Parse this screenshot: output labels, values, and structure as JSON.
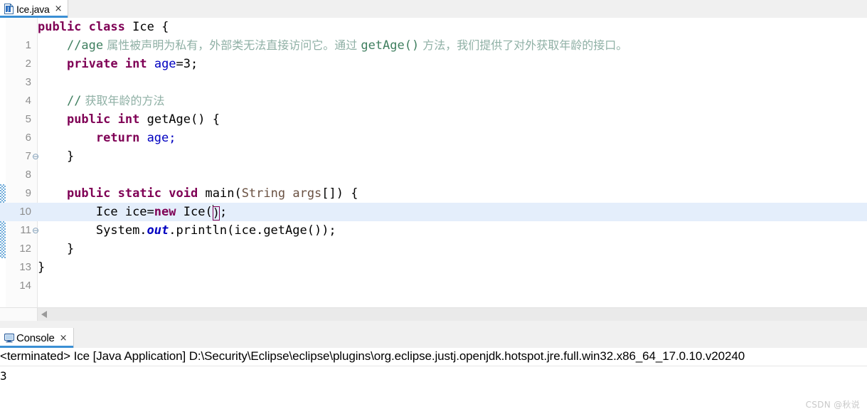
{
  "editor": {
    "tab": {
      "label": "Ice.java",
      "icon": "java-file-icon",
      "close_label": "×"
    },
    "lines": [
      {
        "num": "1",
        "fold": "",
        "current": false,
        "change": false
      },
      {
        "num": "2",
        "fold": "",
        "current": false,
        "change": false
      },
      {
        "num": "3",
        "fold": "",
        "current": false,
        "change": false
      },
      {
        "num": "4",
        "fold": "",
        "current": false,
        "change": false
      },
      {
        "num": "5",
        "fold": "",
        "current": false,
        "change": false
      },
      {
        "num": "6",
        "fold": "⊖",
        "current": false,
        "change": false
      },
      {
        "num": "7",
        "fold": "",
        "current": false,
        "change": false
      },
      {
        "num": "8",
        "fold": "",
        "current": false,
        "change": false
      },
      {
        "num": "9",
        "fold": "",
        "current": false,
        "change": false
      },
      {
        "num": "10",
        "fold": "⊖",
        "current": false,
        "change": true
      },
      {
        "num": "11",
        "fold": "",
        "current": true,
        "change": true
      },
      {
        "num": "12",
        "fold": "",
        "current": false,
        "change": true
      },
      {
        "num": "13",
        "fold": "",
        "current": false,
        "change": true
      },
      {
        "num": "14",
        "fold": "",
        "current": false,
        "change": false
      }
    ],
    "code_text": [
      "public class Ice {",
      "    //age 属性被声明为私有，外部类无法直接访问它。通过 getAge() 方法，我们提供了对外获取年龄的接口。",
      "    private int age=3;",
      "",
      "    // 获取年龄的方法",
      "    public int getAge() {",
      "        return age;",
      "    }",
      "",
      "    public static void main(String args[]) {",
      "        Ice ice=new Ice();",
      "        System.out.println(ice.getAge());",
      "    }",
      "}"
    ],
    "comment_line2": {
      "slashes": "//age",
      "cjk": " 属性被声明为私有，外部类无法直接访问它。通过 ",
      "code": "getAge()",
      "cjk2": " 方法，我们提供了对外获取年龄的接口。"
    },
    "comment_line5": {
      "slashes": "//",
      "cjk": " 获取年龄的方法"
    },
    "tokens": {
      "public": "public",
      "class": "class",
      "private": "private",
      "static": "static",
      "void": "void",
      "int": "int",
      "return": "return",
      "new": "new",
      "ice_type": "Ice",
      "brace_open": " {",
      "brace_close": "}",
      "age": "age",
      "age_init": "=3;",
      "getage_sig": "getAge() {",
      "return_age": "age;",
      "main_sig": "main(",
      "string_type": "String",
      "args": " args",
      "args_brackets": "[]) {",
      "decl_ice": "Ice ice=",
      "new_call": "Ice(",
      "paren_close": ")",
      "semicolon": ";",
      "system": "System.",
      "out": "out",
      "println_call": ".println(ice.getAge());",
      "space4": "    ",
      "space8": "        "
    },
    "scrollbar": {
      "left_arrow": "scroll-left-arrow"
    }
  },
  "console": {
    "tab": {
      "label": "Console",
      "icon": "console-icon",
      "close_label": "×"
    },
    "header": "<terminated> Ice [Java Application] D:\\Security\\Eclipse\\eclipse\\plugins\\org.eclipse.justj.openjdk.hotspot.jre.full.win32.x86_64_17.0.10.v20240",
    "output": "3"
  },
  "watermark": "CSDN @秋说",
  "colors": {
    "keyword": "#7f0055",
    "field": "#0000c0",
    "comment": "#3f7f5f",
    "comment_cjk": "#8fb0a5",
    "parameter": "#6a5142",
    "current_line": "#e4eefb",
    "tab_underline": "#3a8fd4",
    "change_bar": "#5a9fd4",
    "bracket_match": "#7f0055"
  }
}
